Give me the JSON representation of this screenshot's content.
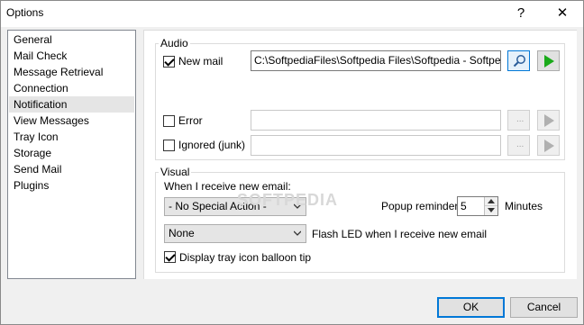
{
  "window": {
    "title": "Options",
    "help_glyph": "?",
    "close_glyph": "✕"
  },
  "nav": {
    "items": [
      "General",
      "Mail Check",
      "Message Retrieval",
      "Connection",
      "Notification",
      "View Messages",
      "Tray Icon",
      "Storage",
      "Send Mail",
      "Plugins"
    ],
    "selected": "Notification"
  },
  "audio": {
    "group_label": "Audio",
    "new_mail": {
      "label": "New mail",
      "checked": true,
      "path": "C:\\SoftpediaFiles\\Softpedia Files\\Softpedia - Softpedia.mp"
    },
    "error": {
      "label": "Error",
      "checked": false,
      "path": ""
    },
    "ignored": {
      "label": "Ignored (junk)",
      "checked": false,
      "path": ""
    },
    "browse_label": "...",
    "browse_icon": "search-icon",
    "play_icon": "play-icon"
  },
  "visual": {
    "group_label": "Visual",
    "when_receive_label": "When I receive new email:",
    "special_action": "- No Special Action -",
    "popup_reminder_label": "Popup reminder:",
    "popup_reminder_value": "5",
    "minutes_label": "Minutes",
    "flash_led_value": "None",
    "flash_led_label": "Flash LED when I receive new email",
    "balloon_tip": {
      "label": "Display tray icon balloon tip",
      "checked": true
    }
  },
  "footer": {
    "ok_label": "OK",
    "cancel_label": "Cancel"
  },
  "watermark": "SOFTPEDIA",
  "colors": {
    "accent": "#0078d7",
    "play_green": "#1aaa1a",
    "selection": "#e5e5e5"
  }
}
